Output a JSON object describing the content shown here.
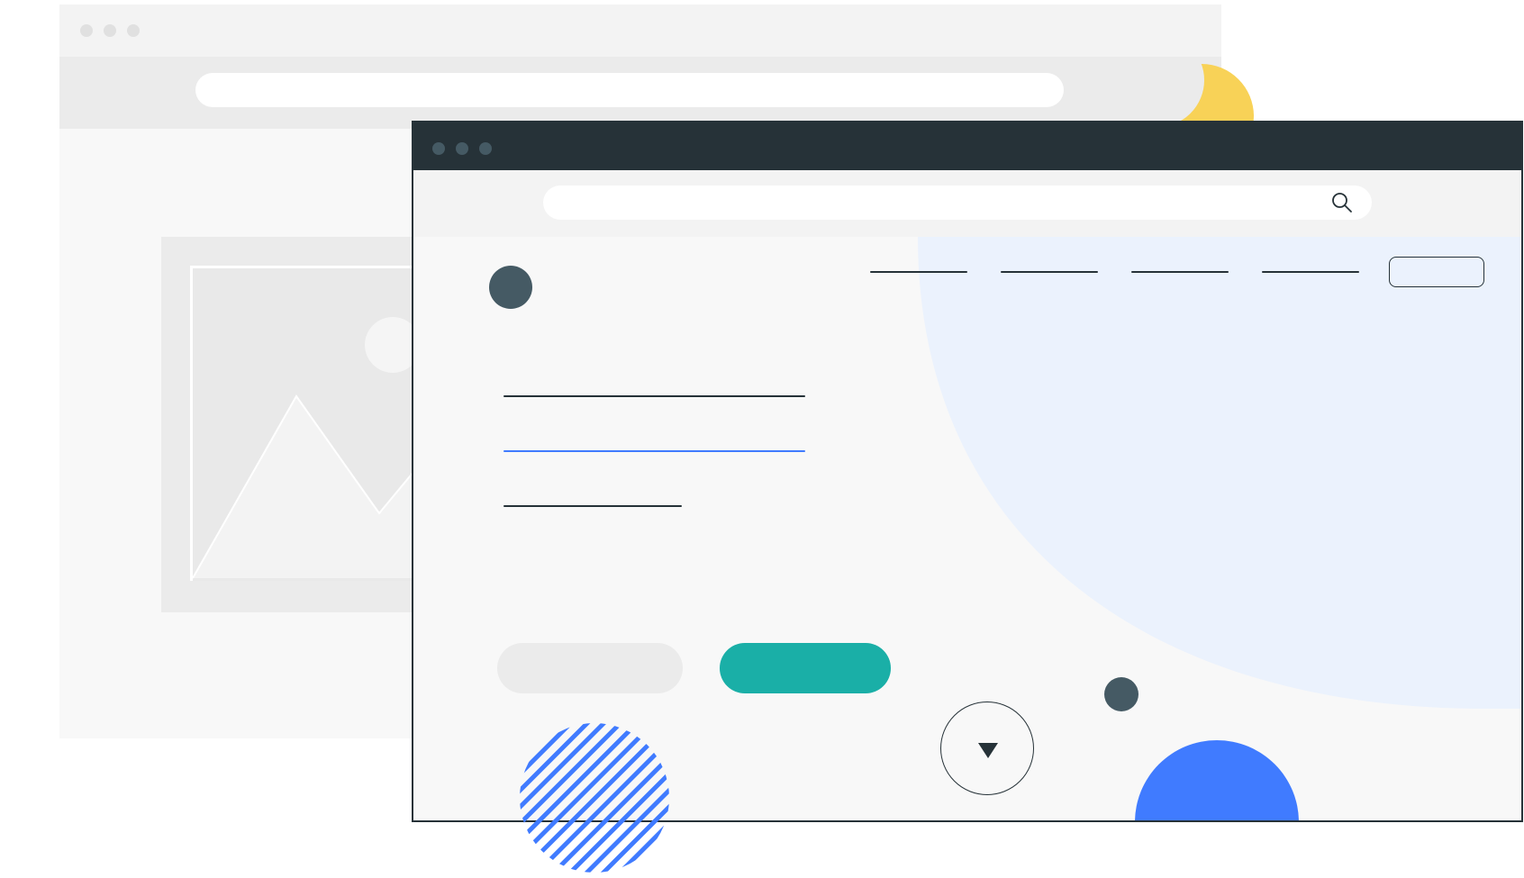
{
  "colors": {
    "dark": "#263238",
    "slate": "#455a64",
    "teal": "#1aafa7",
    "blue": "#407bff",
    "light_blue": "#ebf2fd",
    "yellow": "#f8d257",
    "gray_light": "#f8f8f8",
    "gray_mid": "#ebebeb"
  },
  "icons": {
    "search": "search-icon",
    "moon": "moon-icon",
    "scroll": "chevron-down-icon",
    "image": "image-placeholder-icon"
  },
  "back_window": {
    "address_bar_value": "",
    "image_placeholder": "image-placeholder-icon"
  },
  "front_window": {
    "address_bar_value": "",
    "nav_items": [
      "",
      "",
      "",
      ""
    ],
    "cta_label": "",
    "hero_lines": [
      "",
      "",
      ""
    ],
    "buttons": {
      "secondary_label": "",
      "primary_label": ""
    }
  }
}
